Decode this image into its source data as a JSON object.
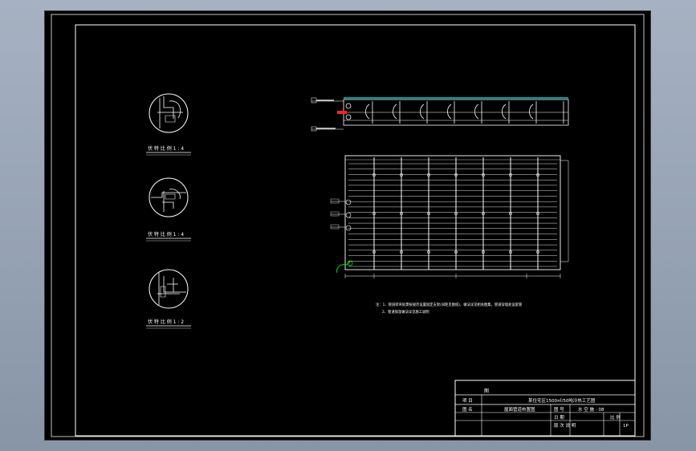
{
  "colors": {
    "background": "#000000",
    "line": "#ffffff",
    "accent_cyan": "#00c8d0",
    "accent_red": "#ff2020",
    "accent_green": "#00e000"
  },
  "details": [
    {
      "label": "伏 特  比 例 1 : 4"
    },
    {
      "label": "伏 特  比 例 1 : 4"
    },
    {
      "label": "伏 特  比 例 1 : 2"
    }
  ],
  "notes": {
    "line1": "注：1、管道转弯处需按规范设置固定支架(间距见图纸)，做法详见相关图集，管道穿墙处设套管",
    "line2": "2、管道保温做法详见施工说明"
  },
  "title_block": {
    "mark": "图",
    "row1_left": "项 目",
    "row1_title": "某住宅区1500㎡/50吨冷热工艺图",
    "row2_left": "图 名",
    "row2_name": "屋面管道布置图",
    "row2_num_label": "图 号",
    "row2_num_value": "水 空 施 - 08",
    "row3_date_label": "日 期",
    "row3_scale_label": "比 例",
    "row4_label": "版 次 说 明",
    "row4_value": "1P"
  }
}
